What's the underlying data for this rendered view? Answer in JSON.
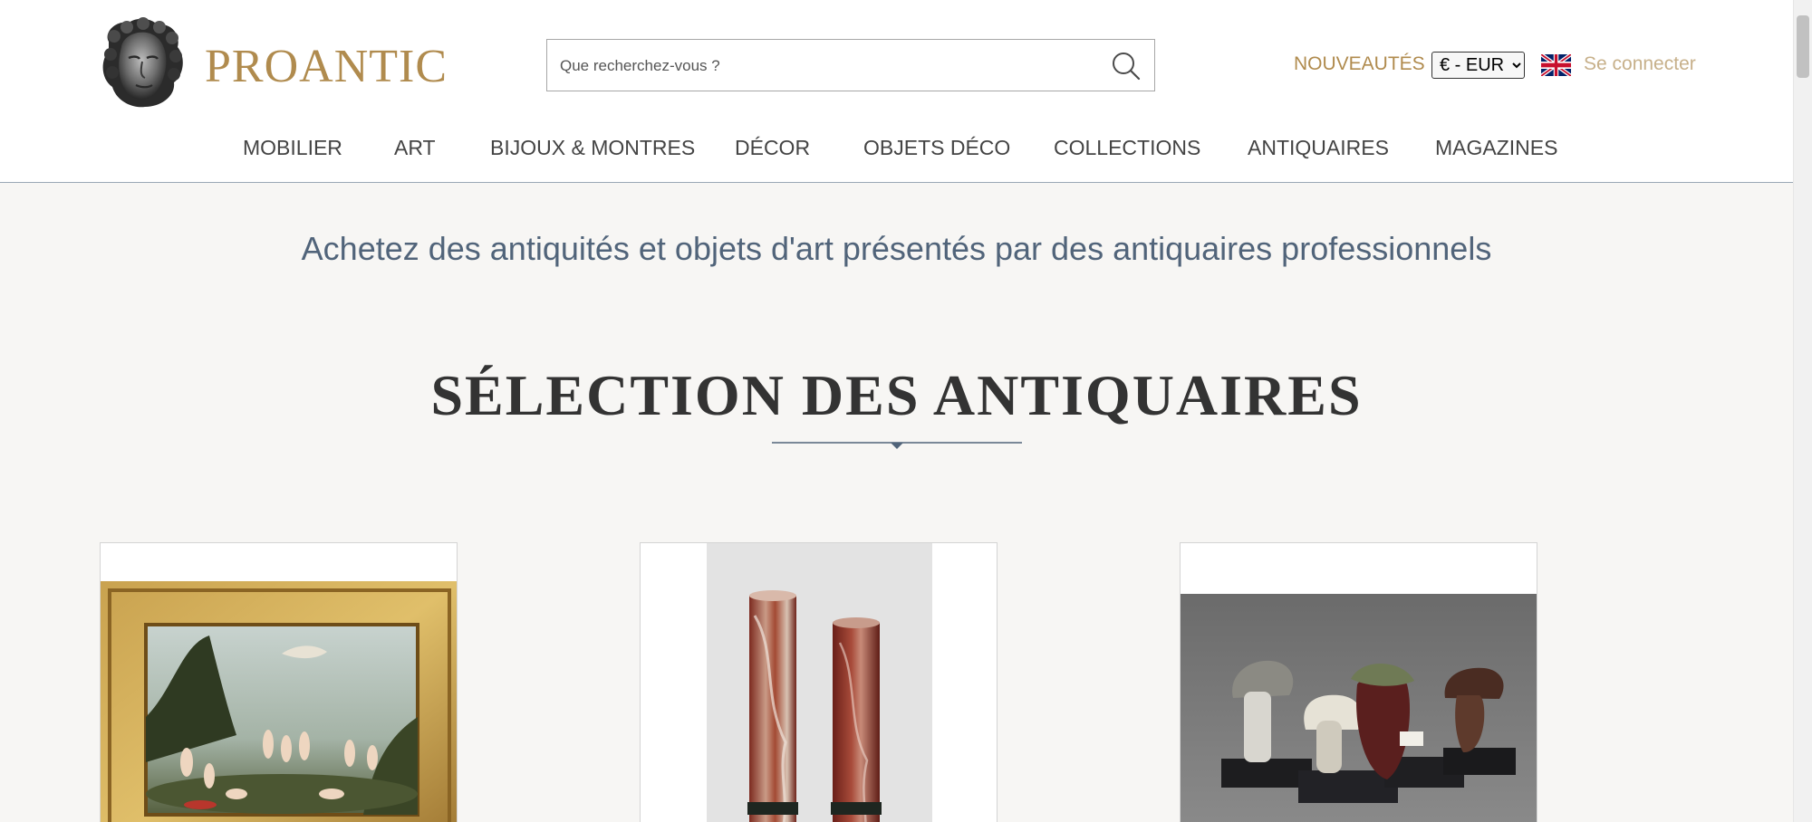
{
  "brand": {
    "name": "PROANTIC",
    "logo_icon": "classical-head-sculpture-icon"
  },
  "search": {
    "placeholder": "Que recherchez-vous ?",
    "value": "",
    "icon": "search-icon"
  },
  "header_links": {
    "new_label": "NOUVEAUTÉS",
    "currency_selected": "€ - EUR",
    "language_flag": "uk-flag-icon",
    "login_label": "Se connecter"
  },
  "nav": {
    "items": [
      {
        "label": "MOBILIER"
      },
      {
        "label": "ART"
      },
      {
        "label": "BIJOUX & MONTRES"
      },
      {
        "label": "DÉCOR"
      },
      {
        "label": "OBJETS DÉCO"
      },
      {
        "label": "COLLECTIONS"
      },
      {
        "label": "ANTIQUAIRES"
      },
      {
        "label": "MAGAZINES"
      }
    ]
  },
  "hero": {
    "tagline": "Achetez des antiquités et objets d'art présentés par des antiquaires professionnels"
  },
  "selection": {
    "title": "SÉLECTION DES ANTIQUAIRES",
    "cards": [
      {
        "image": "framed-mythological-painting"
      },
      {
        "image": "red-marble-columns"
      },
      {
        "image": "mushroom-models"
      }
    ]
  },
  "colors": {
    "brand_gold": "#b08b4e",
    "login_gold": "#c7b08a",
    "slate_blue": "#51647a",
    "page_bg": "#f7f6f4"
  }
}
